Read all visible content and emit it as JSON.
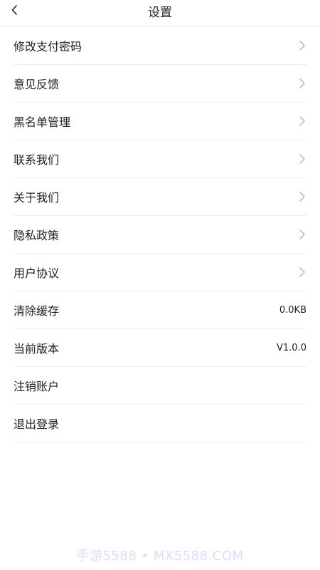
{
  "header": {
    "title": "设置",
    "back_icon": "chevron-left-icon"
  },
  "items": [
    {
      "label": "修改支付密码",
      "value": "",
      "has_arrow": true
    },
    {
      "label": "意见反馈",
      "value": "",
      "has_arrow": true
    },
    {
      "label": "黑名单管理",
      "value": "",
      "has_arrow": true
    },
    {
      "label": "联系我们",
      "value": "",
      "has_arrow": true
    },
    {
      "label": "关于我们",
      "value": "",
      "has_arrow": true
    },
    {
      "label": "隐私政策",
      "value": "",
      "has_arrow": true
    },
    {
      "label": "用户协议",
      "value": "",
      "has_arrow": true
    },
    {
      "label": "清除缓存",
      "value": "0.0KB",
      "has_arrow": false
    },
    {
      "label": "当前版本",
      "value": "V1.0.0",
      "has_arrow": false
    },
    {
      "label": "注销账户",
      "value": "",
      "has_arrow": false
    },
    {
      "label": "退出登录",
      "value": "",
      "has_arrow": false
    }
  ],
  "watermark": "手游5588 • MX5588.COM",
  "colors": {
    "text": "#222222",
    "divider": "#eeeeee",
    "chevron": "#b5b5b5"
  }
}
